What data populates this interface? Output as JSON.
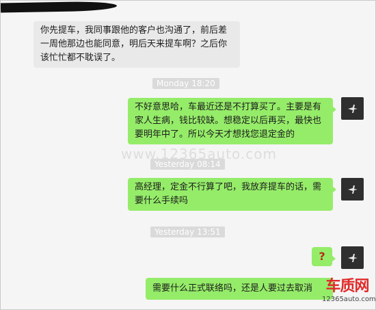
{
  "conversation": {
    "messages": [
      {
        "direction": "incoming",
        "text": "你先提车，我同事跟他的客户也沟通了，前后差\n一周他那边也能同意，明后天来提车啊？之后你\n该忙忙都不耽误了。"
      },
      {
        "direction": "outgoing",
        "text": "不好意思哈，车最近还是不打算买了。主要是有\n家人生病，钱比较缺。想稳定以后再买，最快也\n要明年中了。所以今天才想找您退定金的"
      },
      {
        "direction": "outgoing",
        "text": "高经理，定金不行算了吧，我放弃提车的话，需\n要什么手续吗"
      },
      {
        "direction": "outgoing",
        "text": "?"
      },
      {
        "direction": "outgoing",
        "text": "需要什么正式联络吗，还是人要过去取消"
      }
    ],
    "timestamps": [
      "Monday 18:20",
      "Yesterday 08:14",
      "Yesterday 13:51"
    ]
  },
  "watermark": "www.12365auto.com",
  "logo": {
    "main": "车质网",
    "sub": "12365auto.com"
  },
  "colors": {
    "outgoing_bubble": "#95ec69",
    "incoming_bubble": "#e9e9e9",
    "background": "#f5f5f5",
    "avatar": "#2f2f2f",
    "logo_red": "#e02a2a"
  },
  "icons": {
    "avatar": "contact-avatar-icon"
  }
}
